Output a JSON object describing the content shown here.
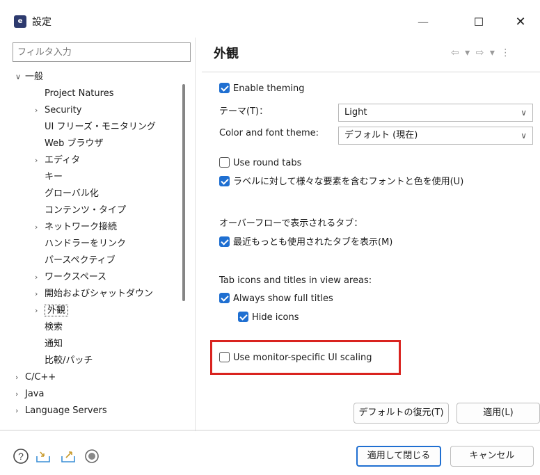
{
  "window": {
    "title": "設定",
    "app_icon_text": "e"
  },
  "left": {
    "filter_placeholder": "フィルタ入力",
    "tree": [
      {
        "label": "一般",
        "level": 0,
        "expander": "open"
      },
      {
        "label": "Project Natures",
        "level": 1,
        "expander": "none"
      },
      {
        "label": "Security",
        "level": 1,
        "expander": "closed"
      },
      {
        "label": "UI フリーズ・モニタリング",
        "level": 1,
        "expander": "none"
      },
      {
        "label": "Web ブラウザ",
        "level": 1,
        "expander": "none"
      },
      {
        "label": "エディタ",
        "level": 1,
        "expander": "closed"
      },
      {
        "label": "キー",
        "level": 1,
        "expander": "none"
      },
      {
        "label": "グローバル化",
        "level": 1,
        "expander": "none"
      },
      {
        "label": "コンテンツ・タイプ",
        "level": 1,
        "expander": "none"
      },
      {
        "label": "ネットワーク接続",
        "level": 1,
        "expander": "closed"
      },
      {
        "label": "ハンドラーをリンク",
        "level": 1,
        "expander": "none"
      },
      {
        "label": "パースペクティブ",
        "level": 1,
        "expander": "none"
      },
      {
        "label": "ワークスペース",
        "level": 1,
        "expander": "closed"
      },
      {
        "label": "開始およびシャットダウン",
        "level": 1,
        "expander": "closed"
      },
      {
        "label": "外観",
        "level": 1,
        "expander": "closed",
        "selected": true
      },
      {
        "label": "検索",
        "level": 1,
        "expander": "none"
      },
      {
        "label": "通知",
        "level": 1,
        "expander": "none"
      },
      {
        "label": "比較/パッチ",
        "level": 1,
        "expander": "none"
      },
      {
        "label": "C/C++",
        "level": 0,
        "expander": "closed"
      },
      {
        "label": "Java",
        "level": 0,
        "expander": "closed"
      },
      {
        "label": "Language Servers",
        "level": 0,
        "expander": "closed"
      }
    ]
  },
  "right": {
    "title": "外観",
    "nav": "⇦ ▾ ⇨ ▾ ⋮",
    "enable_theming": {
      "label": "Enable theming",
      "checked": true
    },
    "theme": {
      "label": "テーマ(T)：",
      "value": "Light"
    },
    "color_font_theme": {
      "label": "Color and font theme:",
      "value": "デフォルト (現在)"
    },
    "round_tabs": {
      "label": "Use round tabs",
      "checked": false
    },
    "mixed_fonts": {
      "label": "ラベルに対して様々な要素を含むフォントと色を使用(U)",
      "checked": true
    },
    "overflow_label": "オーバーフローで表示されるタブ：",
    "recent_tabs": {
      "label": "最近もっとも使用されたタブを表示(M)",
      "checked": true
    },
    "tab_icons_label": "Tab icons and titles in view areas:",
    "full_titles": {
      "label": "Always show full titles",
      "checked": true
    },
    "hide_icons": {
      "label": "Hide icons",
      "checked": true
    },
    "monitor_scaling": {
      "label": "Use monitor-specific UI scaling",
      "checked": false
    },
    "restore_defaults": "デフォルトの復元(T)",
    "apply": "適用(L)"
  },
  "footer": {
    "apply_close": "適用して閉じる",
    "cancel": "キャンセル",
    "icons": [
      "help-icon",
      "import-icon",
      "export-icon",
      "record-icon"
    ]
  },
  "colors": {
    "accent": "#1f6fd1",
    "highlight": "#d9231f"
  }
}
